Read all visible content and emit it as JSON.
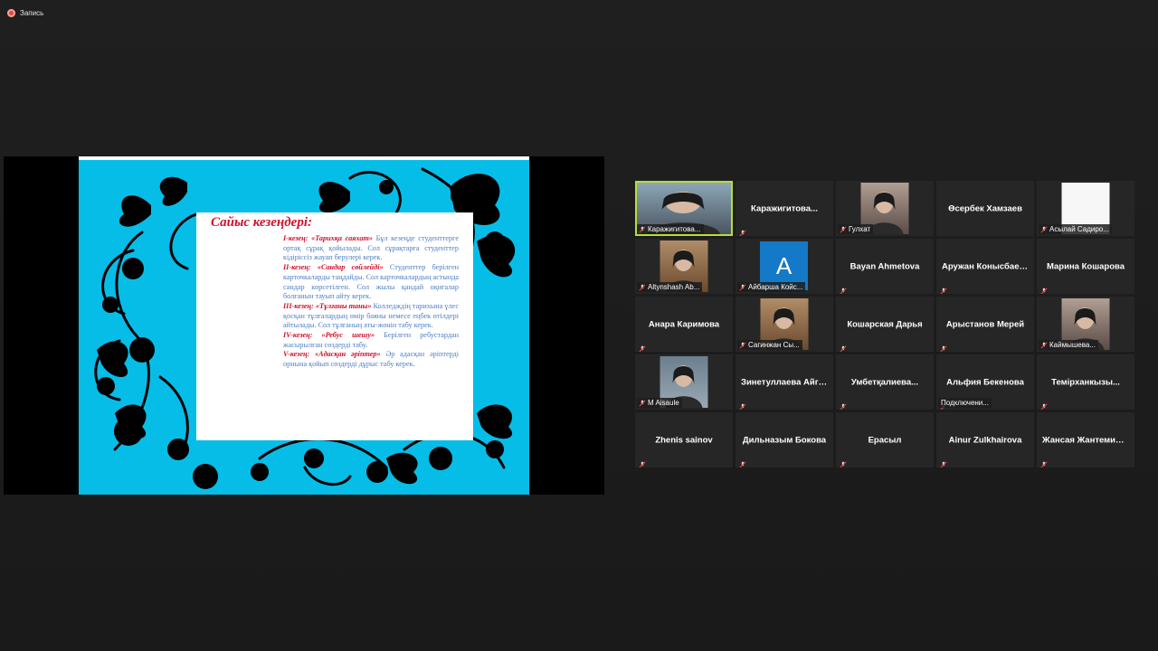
{
  "recording": {
    "label": "Запись"
  },
  "slide": {
    "title": "Сайыс кезеңдері:",
    "stages": [
      {
        "stage": "I-кезең: «Тарихқа саяхат»",
        "text": " Бұл кезеңде студенттерге ортақ сұрақ қойылады. Сол сұрақтарға студенттер кідіріссіз жауап берулері керек."
      },
      {
        "stage": "II-кезең: «Сандар сөйлейді»",
        "text": " Студенттер берілген карточкаларды таңдайды. Сол карточкалардың астында сандар көрсетілген. Сол жылы қандай оқиғалар болғанын тауып айту керек."
      },
      {
        "stage": "III-кезең: «Тұлғаны таны»",
        "text": " Колледждің тарихына үлес қосқан тұлғалардың өмір баяны немесе еңбек өтілдері айтылады. Сол тұлғаның аты-жөнін табу керек."
      },
      {
        "stage": "IV-кезең: «Ребус шешу»",
        "text": " Берілген ребустардан жасырылған сөздерді табу."
      },
      {
        "stage": "V-кезең: «Адасқан әріптер»",
        "text": " Әр адасқан әріптерді орнына қойып сөздерді дұрыс табу керек."
      }
    ]
  },
  "participants": [
    {
      "name": "Каражигитова...",
      "kind": "video",
      "active": true
    },
    {
      "name": "Каражигитова...",
      "kind": "name"
    },
    {
      "name": "Гулхат",
      "kind": "video"
    },
    {
      "name": "Өсербек Хамзаев",
      "kind": "name",
      "nomute": true
    },
    {
      "name": "Асылай Садиро...",
      "kind": "video-white"
    },
    {
      "name": "Altynshash Ab...",
      "kind": "video"
    },
    {
      "name": "Айбарша Койс...",
      "kind": "avatar",
      "initial": "A"
    },
    {
      "name": "Bayan Ahmetova",
      "kind": "name"
    },
    {
      "name": "Аружан Конысбаева",
      "kind": "name"
    },
    {
      "name": "Марина Кошарова",
      "kind": "name"
    },
    {
      "name": "Анара Каримова",
      "kind": "name"
    },
    {
      "name": "Сагинжан Сы...",
      "kind": "video"
    },
    {
      "name": "Кошарская Дарья",
      "kind": "name"
    },
    {
      "name": "Арыстанов Мерей",
      "kind": "name"
    },
    {
      "name": "Каймышева...",
      "kind": "video"
    },
    {
      "name": "M Aisaule",
      "kind": "video"
    },
    {
      "name": "Зинетуллаева Айгерим",
      "kind": "name"
    },
    {
      "name": "Умбетқалиева...",
      "kind": "name"
    },
    {
      "name": "Альфия Бекенова",
      "kind": "name",
      "status": "Подключени..."
    },
    {
      "name": "Темірханкызы...",
      "kind": "name"
    },
    {
      "name": "Zhenis sainov",
      "kind": "name"
    },
    {
      "name": "Дильназым Бокова",
      "kind": "name"
    },
    {
      "name": "Ерасыл",
      "kind": "name"
    },
    {
      "name": "Ainur Zulkhairova",
      "kind": "name"
    },
    {
      "name": "Жансая Жантемирова",
      "kind": "name"
    }
  ],
  "colors": {
    "accent_active": "#b6dd38",
    "slide_bg": "#06bde8",
    "stage_red": "#d0112b",
    "stage_blue": "#4b7fc6"
  }
}
